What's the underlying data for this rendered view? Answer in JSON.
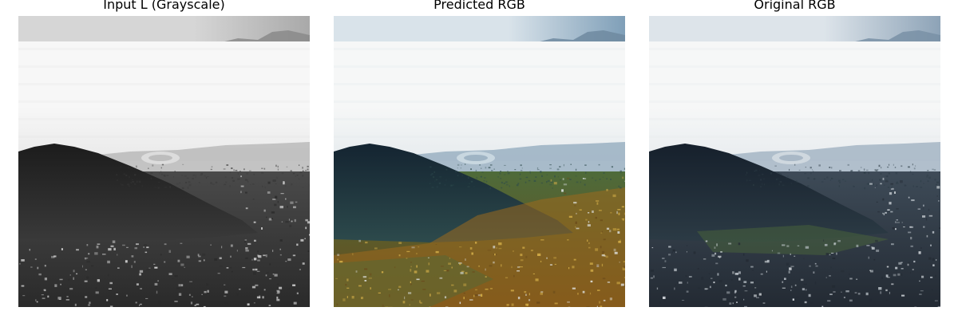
{
  "figure": {
    "panels": [
      {
        "title": "Input L (Grayscale)",
        "mode": "grayscale",
        "palette": {
          "sky_top": "#a9a9a9",
          "sky_mid": "#d6d6d6",
          "mountain": "#8a8a8a",
          "fog_top": "#f7f7f7",
          "fog_bottom": "#e9e9e9",
          "haze": "#bdbdbd",
          "hill_top": "#1c1c1c",
          "hill_bottom": "#3a3a3a",
          "ground_top": "#4a4a4a",
          "ground_bottom": "#2a2a2a",
          "stadium": "#dcdcdc",
          "speck": "#cfcfcf",
          "accent": "#5a5a5a"
        }
      },
      {
        "title": "Predicted RGB",
        "mode": "predicted",
        "palette": {
          "sky_top": "#7f9fb8",
          "sky_mid": "#d9e3ea",
          "mountain": "#6e8aa0",
          "fog_top": "#f6f7f7",
          "fog_bottom": "#e6ebee",
          "haze": "#9fb4c4",
          "hill_top": "#142431",
          "hill_bottom": "#2d4a4c",
          "ground_top": "#4e6b3a",
          "ground_bottom": "#6a4a1a",
          "stadium": "#c8d7e0",
          "speck": "#d8b24a",
          "accent": "#9c6a1e"
        }
      },
      {
        "title": "Original RGB",
        "mode": "original",
        "palette": {
          "sky_top": "#8da3b7",
          "sky_mid": "#dde4ea",
          "mountain": "#7990a6",
          "fog_top": "#f6f7f7",
          "fog_bottom": "#e8ecef",
          "haze": "#a9b8c6",
          "hill_top": "#16202c",
          "hill_bottom": "#2c3b45",
          "ground_top": "#3e4b58",
          "ground_bottom": "#232a33",
          "stadium": "#cfd8df",
          "speck": "#c9d0d6",
          "accent": "#4d6a3a"
        }
      }
    ]
  }
}
